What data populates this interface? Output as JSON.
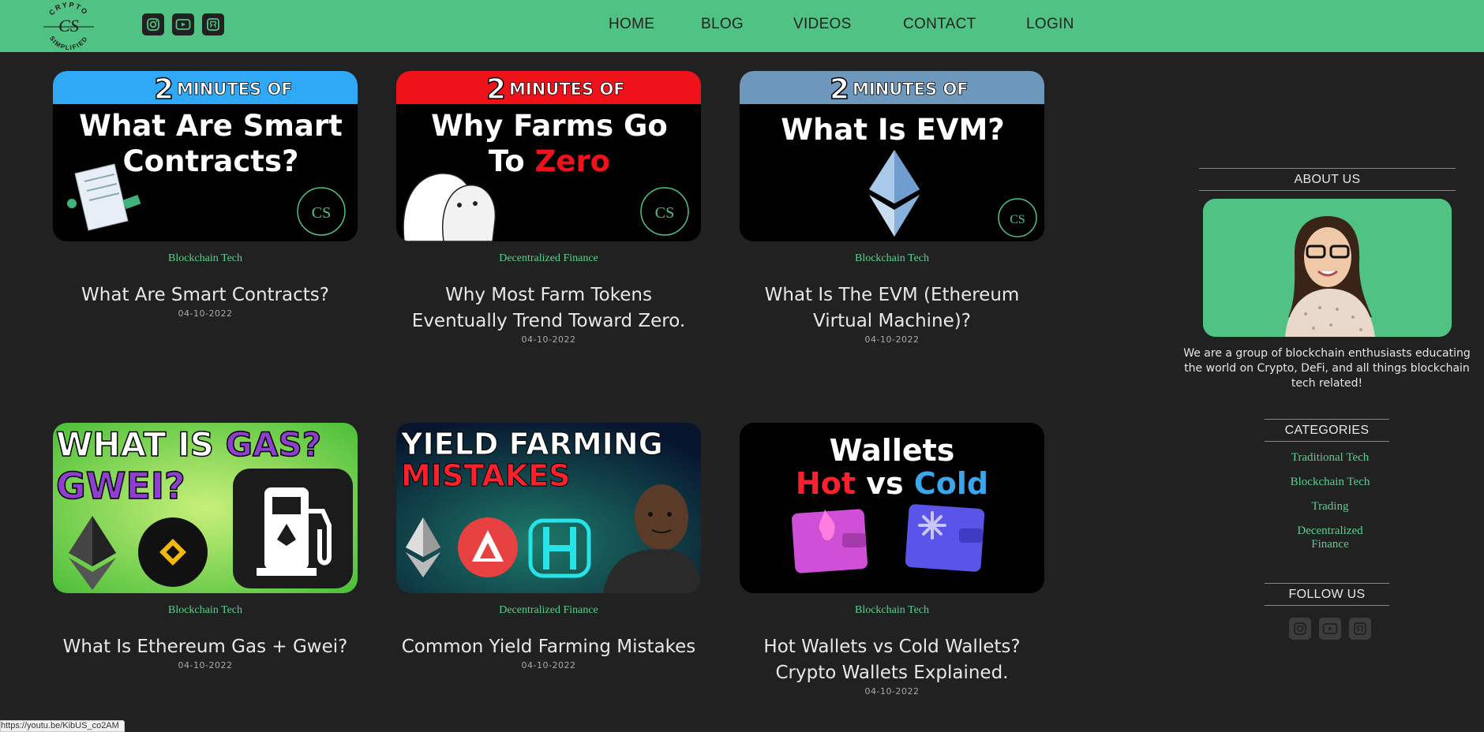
{
  "header": {
    "logo_text_top": "CRYPTO",
    "logo_text_bottom": "SIMPLIFIED",
    "logo_monogram": "CS",
    "social_icons": [
      "instagram-icon",
      "youtube-icon",
      "github-icon"
    ],
    "nav": [
      "HOME",
      "BLOG",
      "VIDEOS",
      "CONTACT",
      "LOGIN"
    ]
  },
  "colors": {
    "brand_green": "#50c283",
    "background": "#212121",
    "category_green": "#5ad08e"
  },
  "thumbnails": {
    "banner_minutes": "2",
    "banner_text": "MINUTES OF",
    "t1_line1": "What Are Smart",
    "t1_line2": "Contracts?",
    "t2_line1": "Why Farms Go",
    "t2_line2_a": "To ",
    "t2_line2_b": "Zero",
    "t3_line1": "What Is EVM?",
    "t4_line1_a": "WHAT IS ",
    "t4_line1_b": "GAS?",
    "t4_line2": "GWEI?",
    "t5_line1": "YIELD FARMING",
    "t5_line2": "MISTAKES",
    "t6_line1": "Wallets",
    "t6_line2_a": "Hot",
    "t6_line2_b": " vs ",
    "t6_line2_c": "Cold"
  },
  "posts": [
    {
      "category": "Blockchain Tech",
      "title": "What Are Smart Contracts?",
      "date": "04-10-2022"
    },
    {
      "category": "Decentralized Finance",
      "title": "Why Most Farm Tokens Eventually Trend Toward Zero.",
      "date": "04-10-2022"
    },
    {
      "category": "Blockchain Tech",
      "title": "What Is The EVM (Ethereum Virtual Machine)?",
      "date": "04-10-2022"
    },
    {
      "category": "Blockchain Tech",
      "title": "What Is Ethereum Gas + Gwei?",
      "date": "04-10-2022"
    },
    {
      "category": "Decentralized Finance",
      "title": "Common Yield Farming Mistakes",
      "date": "04-10-2022"
    },
    {
      "category": "Blockchain Tech",
      "title": "Hot Wallets vs Cold Wallets? Crypto Wallets Explained.",
      "date": "04-10-2022"
    }
  ],
  "sidebar": {
    "about_heading": "ABOUT US",
    "about_text": "We are a group of blockchain enthusiasts educating the world on Crypto, DeFi, and all things blockchain tech related!",
    "categories_heading": "CATEGORIES",
    "categories": [
      "Traditional Tech",
      "Blockchain Tech",
      "Trading",
      "Decentralized Finance"
    ],
    "follow_heading": "FOLLOW US"
  },
  "status_bar": {
    "url": "https://youtu.be/KibUS_co2AM"
  }
}
